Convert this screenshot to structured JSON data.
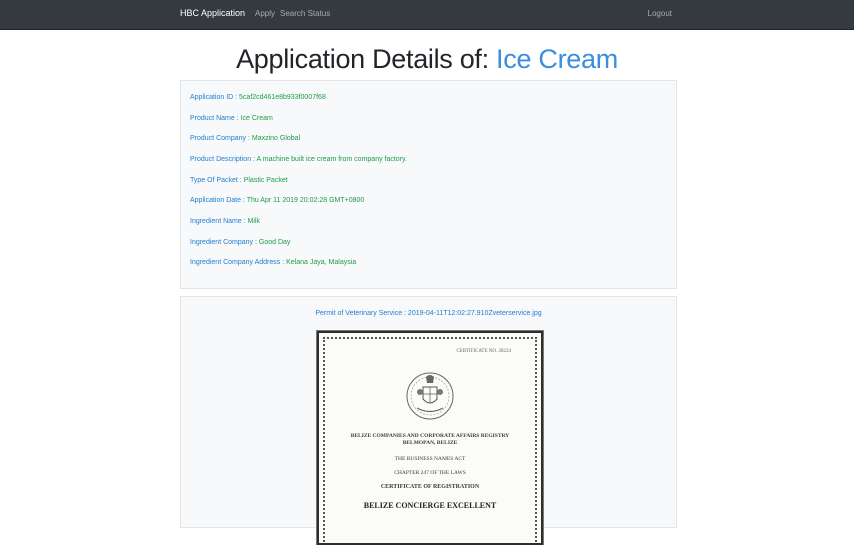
{
  "navbar": {
    "brand": "HBC Application",
    "links": [
      "Apply",
      "Search Status"
    ],
    "logout": "Logout"
  },
  "title": {
    "prefix": "Application Details of: ",
    "name": "Ice Cream"
  },
  "details": [
    {
      "label": "Application ID : ",
      "value": "5caf2cd461e8b933f0007f68"
    },
    {
      "label": "Product Name : ",
      "value": "Ice Cream"
    },
    {
      "label": "Product Company : ",
      "value": "Maxzino Global"
    },
    {
      "label": "Product Description : ",
      "value": "A machine built ice cream from company factory."
    },
    {
      "label": "Type Of Packet : ",
      "value": "Plastic Packet"
    },
    {
      "label": "Application Date : ",
      "value": "Thu Apr 11 2019 20:02:28 GMT+0800"
    },
    {
      "label": "Ingredient Name : ",
      "value": "Milk"
    },
    {
      "label": "Ingredient Company : ",
      "value": "Good Day"
    },
    {
      "label": "Ingredient Company Address : ",
      "value": "Kelana Jaya, Malaysia"
    }
  ],
  "permit": {
    "label": "Permit of Veterinary Service : ",
    "file": "2019-04-11T12:02:27.910Zveterservice.jpg"
  },
  "certificate": {
    "number": "CERTIFICATE NO. 28224",
    "registry": "BELIZE COMPANIES AND CORPORATE AFFAIRS REGISTRY",
    "city": "BELMOPAN, BELIZE",
    "act": "THE BUSINESS NAMES ACT",
    "chapter": "CHAPTER 247 OF THE LAWS",
    "heading": "CERTIFICATE OF REGISTRATION",
    "company": "BELIZE CONCIERGE EXCELLENT"
  },
  "colors": {
    "navbar": "#343a40",
    "label": "#1f7dd1",
    "value": "#1e9a4b",
    "title_accent": "#3a8ee0"
  }
}
